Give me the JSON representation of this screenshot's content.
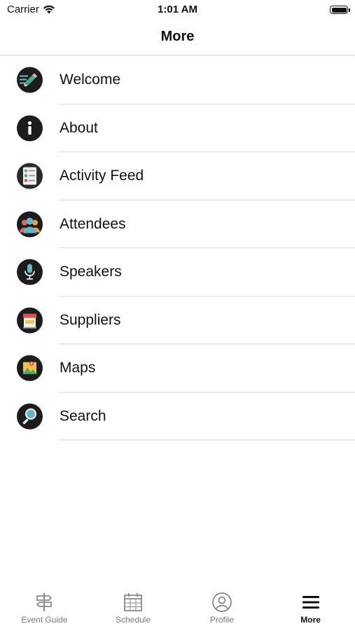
{
  "status_bar": {
    "carrier": "Carrier",
    "time": "1:01 AM"
  },
  "nav": {
    "title": "More"
  },
  "menu": {
    "items": [
      {
        "label": "Welcome",
        "icon": "welcome-pencil-icon"
      },
      {
        "label": "About",
        "icon": "info-icon"
      },
      {
        "label": "Activity Feed",
        "icon": "activity-feed-icon"
      },
      {
        "label": "Attendees",
        "icon": "attendees-icon"
      },
      {
        "label": "Speakers",
        "icon": "microphone-icon"
      },
      {
        "label": "Suppliers",
        "icon": "store-icon"
      },
      {
        "label": "Maps",
        "icon": "map-icon"
      },
      {
        "label": "Search",
        "icon": "search-icon"
      }
    ]
  },
  "tab_bar": {
    "tabs": [
      {
        "label": "Event Guide",
        "icon": "signpost-icon",
        "active": false
      },
      {
        "label": "Schedule",
        "icon": "calendar-icon",
        "active": false
      },
      {
        "label": "Profile",
        "icon": "profile-icon",
        "active": false
      },
      {
        "label": "More",
        "icon": "menu-icon",
        "active": true
      }
    ]
  },
  "colors": {
    "icon_background": "#1c1c1c",
    "separator": "#dcdcdc",
    "tab_inactive": "#7a7a7a",
    "tab_active": "#111111"
  }
}
